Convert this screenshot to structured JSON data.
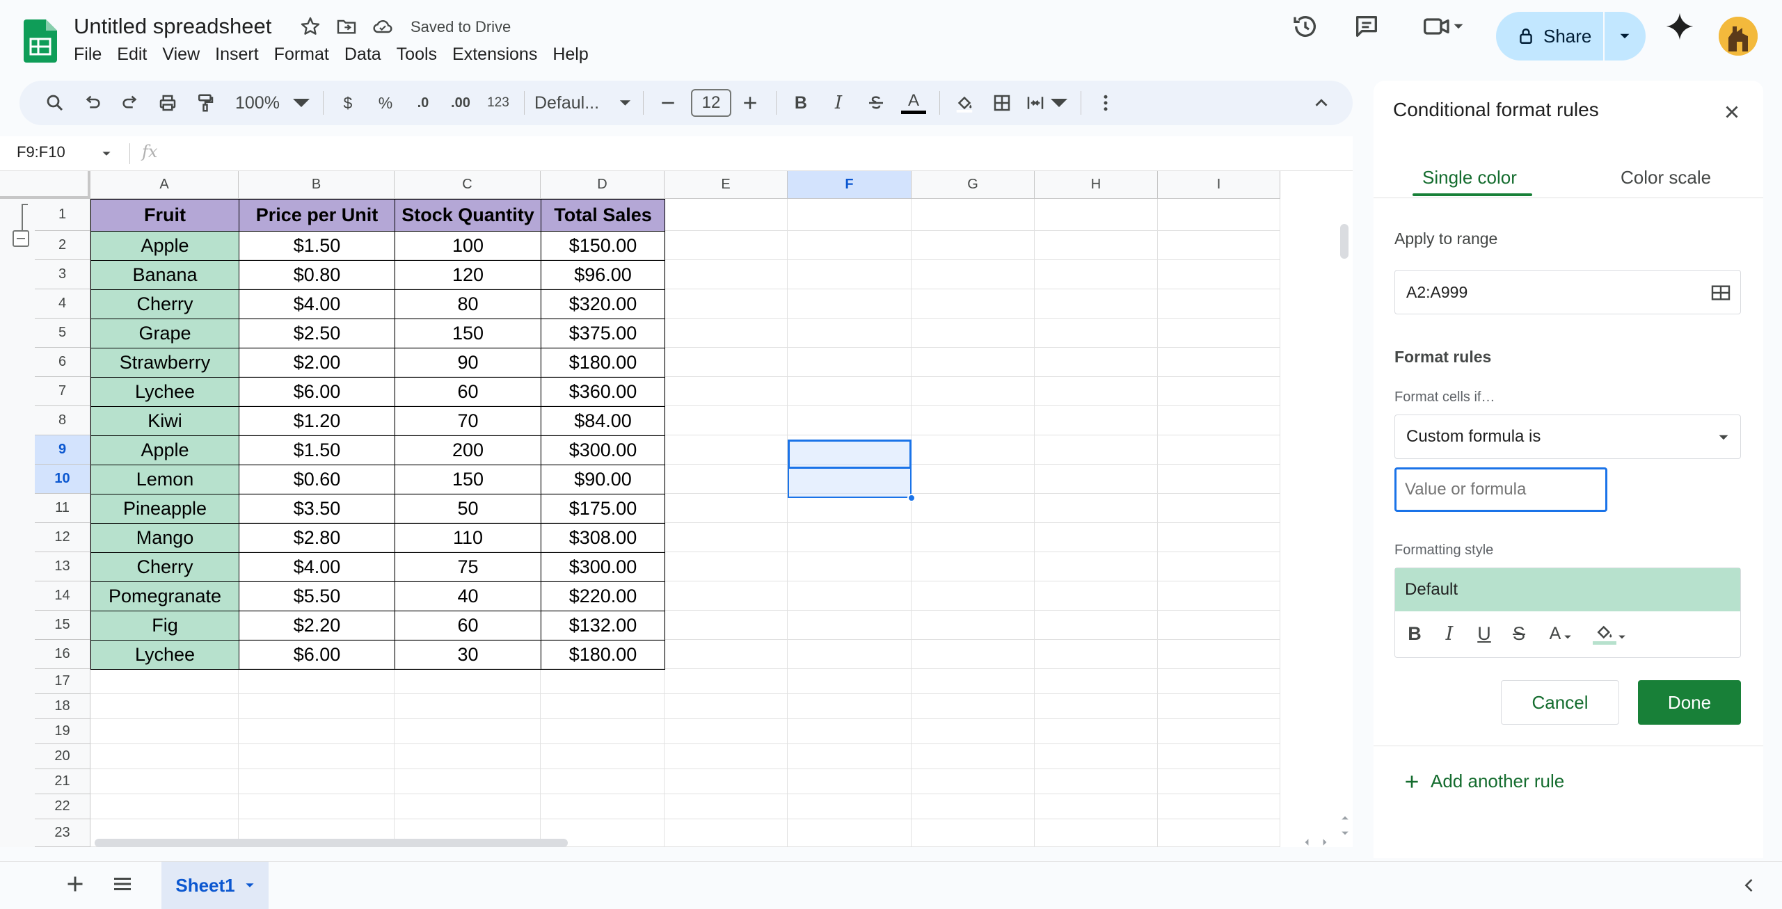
{
  "app": {
    "title": "Untitled spreadsheet",
    "saved_status": "Saved to Drive",
    "menu": [
      "File",
      "Edit",
      "View",
      "Insert",
      "Format",
      "Data",
      "Tools",
      "Extensions",
      "Help"
    ],
    "share_label": "Share"
  },
  "toolbar": {
    "zoom": "100%",
    "currency": "$",
    "percent": "%",
    "dec_decrease": ".0",
    "dec_increase": ".00",
    "more_formats": "123",
    "font": "Defaul...",
    "font_size": "12",
    "bold": "B",
    "italic": "I",
    "underline_text": "A"
  },
  "formula_bar": {
    "namebox": "F9:F10",
    "fx": "fx"
  },
  "sheet": {
    "columns": [
      "A",
      "B",
      "C",
      "D",
      "E",
      "F",
      "G",
      "H",
      "I"
    ],
    "rows": [
      "1",
      "2",
      "3",
      "4",
      "5",
      "6",
      "7",
      "8",
      "9",
      "10",
      "11",
      "12",
      "13",
      "14",
      "15",
      "16",
      "17",
      "18",
      "19",
      "20",
      "21",
      "22",
      "23"
    ],
    "header_row": [
      "Fruit",
      "Price per Unit",
      "Stock Quantity",
      "Total Sales"
    ],
    "data": [
      [
        "Apple",
        "$1.50",
        "100",
        "$150.00"
      ],
      [
        "Banana",
        "$0.80",
        "120",
        "$96.00"
      ],
      [
        "Cherry",
        "$4.00",
        "80",
        "$320.00"
      ],
      [
        "Grape",
        "$2.50",
        "150",
        "$375.00"
      ],
      [
        "Strawberry",
        "$2.00",
        "90",
        "$180.00"
      ],
      [
        "Lychee",
        "$6.00",
        "60",
        "$360.00"
      ],
      [
        "Kiwi",
        "$1.20",
        "70",
        "$84.00"
      ],
      [
        "Apple",
        "$1.50",
        "200",
        "$300.00"
      ],
      [
        "Lemon",
        "$0.60",
        "150",
        "$90.00"
      ],
      [
        "Pineapple",
        "$3.50",
        "50",
        "$175.00"
      ],
      [
        "Mango",
        "$2.80",
        "110",
        "$308.00"
      ],
      [
        "Cherry",
        "$4.00",
        "75",
        "$300.00"
      ],
      [
        "Pomegranate",
        "$5.50",
        "40",
        "$220.00"
      ],
      [
        "Fig",
        "$2.20",
        "60",
        "$132.00"
      ],
      [
        "Lychee",
        "$6.00",
        "30",
        "$180.00"
      ]
    ],
    "selected_column": "F",
    "selected_rows": [
      "9",
      "10"
    ],
    "colors": {
      "header_fill": "#b4a7d6",
      "fruit_fill": "#b7e1cd",
      "selection": "#1a73e8"
    }
  },
  "sheet_tabs": {
    "active": "Sheet1"
  },
  "panel": {
    "title": "Conditional format rules",
    "tab_single": "Single color",
    "tab_scale": "Color scale",
    "apply_label": "Apply to range",
    "range_value": "A2:A999",
    "format_rules_label": "Format rules",
    "format_cells_if": "Format cells if…",
    "condition": "Custom formula is",
    "formula_placeholder": "Value or formula",
    "formatting_style_label": "Formatting style",
    "style_preview": "Default",
    "cancel_label": "Cancel",
    "done_label": "Done",
    "add_rule_label": "Add another rule",
    "accent": "#188038"
  }
}
